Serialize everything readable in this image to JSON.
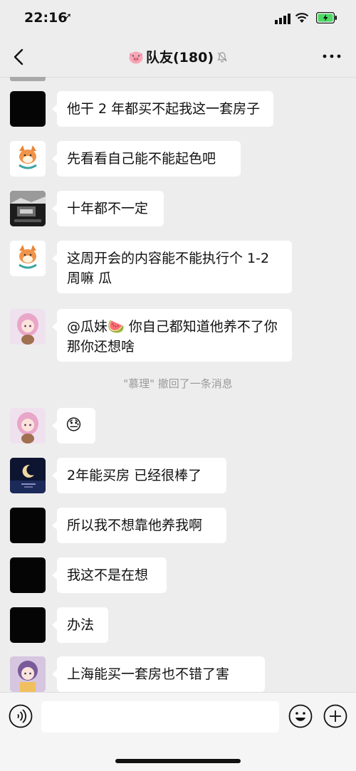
{
  "status_bar": {
    "time": "22:16",
    "location_icon": "location-arrow-icon"
  },
  "header": {
    "title": "队友(180)",
    "back_icon": "chevron-left-icon",
    "more_icon": "ellipsis-icon"
  },
  "messages": [
    {
      "text": "他干 2 年都买不起我这一套房子",
      "avatar": "black"
    },
    {
      "text": "先看看自己能不能起色吧",
      "avatar": "shiba"
    },
    {
      "text": "十年都不一定",
      "avatar": "mono-photo"
    },
    {
      "text": "这周开会的内容能不能执行个 1-2 周嘛 瓜",
      "avatar": "shiba"
    },
    {
      "text": "@瓜妹🍉 你自己都知道他养不了你那你还想啥",
      "avatar": "anime-girl"
    },
    {
      "text": "😓",
      "avatar": "anime-girl"
    },
    {
      "text": "2年能买房 已经很棒了",
      "avatar": "moon-night"
    },
    {
      "text": "所以我不想靠他养我啊",
      "avatar": "black"
    },
    {
      "text": "我这不是在想",
      "avatar": "black"
    },
    {
      "text": "办法",
      "avatar": "black"
    },
    {
      "text": "上海能买一套房也不错了害",
      "avatar": "anime-girl-2"
    }
  ],
  "system_message": "\"慕理\" 撤回了一条消息",
  "input_bar": {
    "voice_icon": "voice-icon",
    "text_value": "",
    "emoji_icon": "emoji-icon",
    "plus_icon": "plus-icon"
  }
}
